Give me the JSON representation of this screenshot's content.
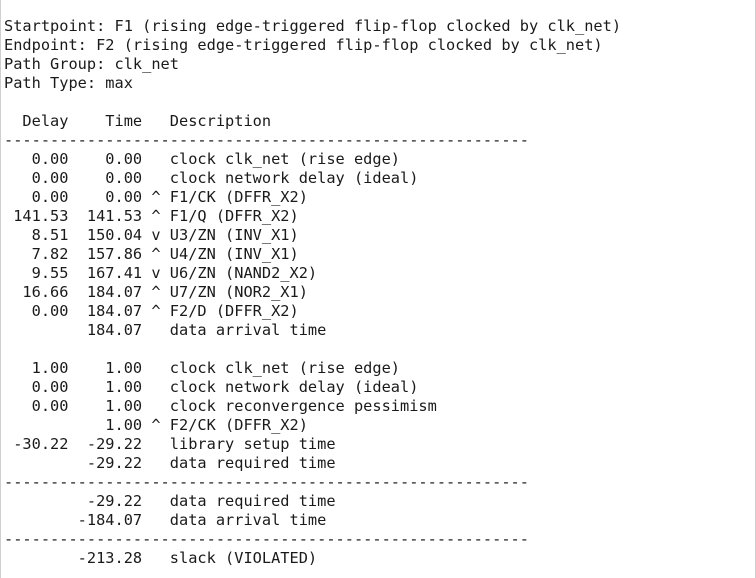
{
  "header": {
    "startpoint": "Startpoint: F1 (rising edge-triggered flip-flop clocked by clk_net)",
    "endpoint": "Endpoint: F2 (rising edge-triggered flip-flop clocked by clk_net)",
    "path_group": "Path Group: clk_net",
    "path_type": "Path Type: max"
  },
  "table": {
    "column_header": "  Delay    Time   Description",
    "separator": "---------------------------------------------------------",
    "arrival_rows": [
      "   0.00    0.00   clock clk_net (rise edge)",
      "   0.00    0.00   clock network delay (ideal)",
      "   0.00    0.00 ^ F1/CK (DFFR_X2)",
      " 141.53  141.53 ^ F1/Q (DFFR_X2)",
      "   8.51  150.04 v U3/ZN (INV_X1)",
      "   7.82  157.86 ^ U4/ZN (INV_X1)",
      "   9.55  167.41 v U6/ZN (NAND2_X2)",
      "  16.66  184.07 ^ U7/ZN (NOR2_X1)",
      "   0.00  184.07 ^ F2/D (DFFR_X2)",
      "         184.07   data arrival time"
    ],
    "required_rows": [
      "   1.00    1.00   clock clk_net (rise edge)",
      "   0.00    1.00   clock network delay (ideal)",
      "   0.00    1.00   clock reconvergence pessimism",
      "           1.00 ^ F2/CK (DFFR_X2)",
      " -30.22  -29.22   library setup time",
      "         -29.22   data required time"
    ],
    "summary_rows": [
      "         -29.22   data required time",
      "        -184.07   data arrival time"
    ],
    "slack_row": "        -213.28   slack (VIOLATED)"
  }
}
